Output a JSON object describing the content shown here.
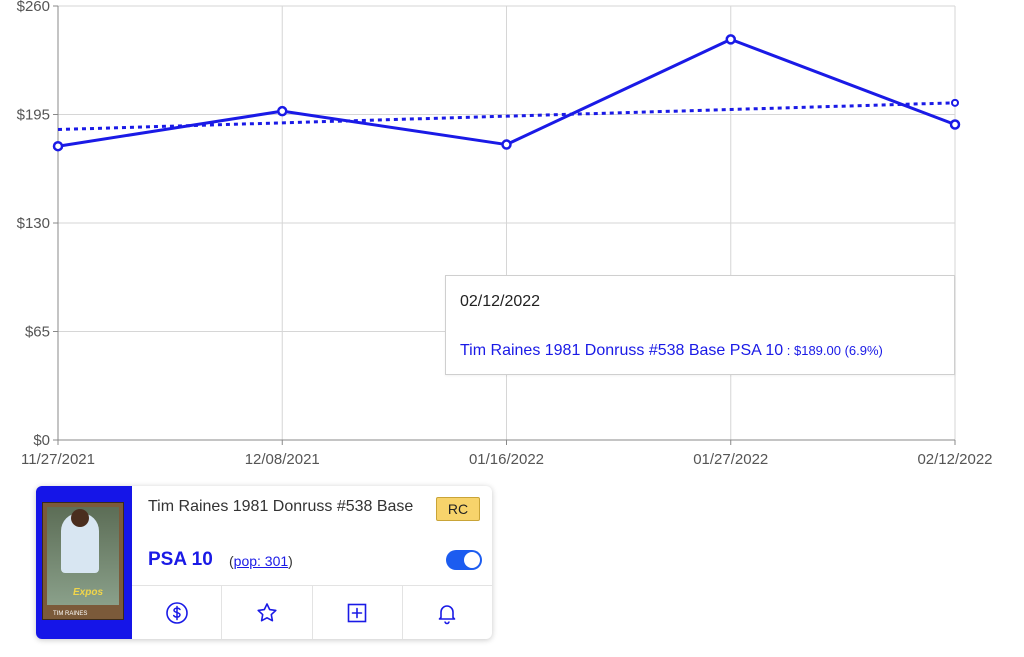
{
  "chart_data": {
    "type": "line",
    "x": [
      "11/27/2021",
      "12/08/2021",
      "01/16/2022",
      "01/27/2022",
      "02/12/2022"
    ],
    "series": [
      {
        "name": "Tim Raines 1981 Donruss #538 Base PSA 10",
        "values": [
          176,
          197,
          177,
          240,
          189
        ],
        "style": "solid"
      },
      {
        "name": "",
        "values": [
          186,
          190,
          194,
          198,
          202
        ],
        "style": "dotted",
        "role": "trend"
      }
    ],
    "ylim": [
      0,
      260
    ],
    "yticks": [
      "$0",
      "$65",
      "$130",
      "$195",
      "$260"
    ],
    "ytick_values": [
      0,
      65,
      130,
      195,
      260
    ],
    "grid": true,
    "color": "#1a1ae6"
  },
  "tooltip": {
    "date": "02/12/2022",
    "name": "Tim Raines 1981 Donruss #538 Base PSA 10",
    "value": " : $189.00 (6.9%)"
  },
  "card": {
    "title": "Tim Raines 1981 Donruss #538 Base",
    "badge": "RC",
    "grade": "PSA 10",
    "pop_open": "(",
    "pop_link": "pop: 301",
    "pop_close": ")",
    "image_team": "Expos",
    "image_name": "TIM RAINES",
    "actions": [
      {
        "icon": "dollar-circle-icon"
      },
      {
        "icon": "star-icon"
      },
      {
        "icon": "plus-square-icon"
      },
      {
        "icon": "bell-icon"
      }
    ],
    "accent": "#1515e8",
    "toggle_on": true
  }
}
